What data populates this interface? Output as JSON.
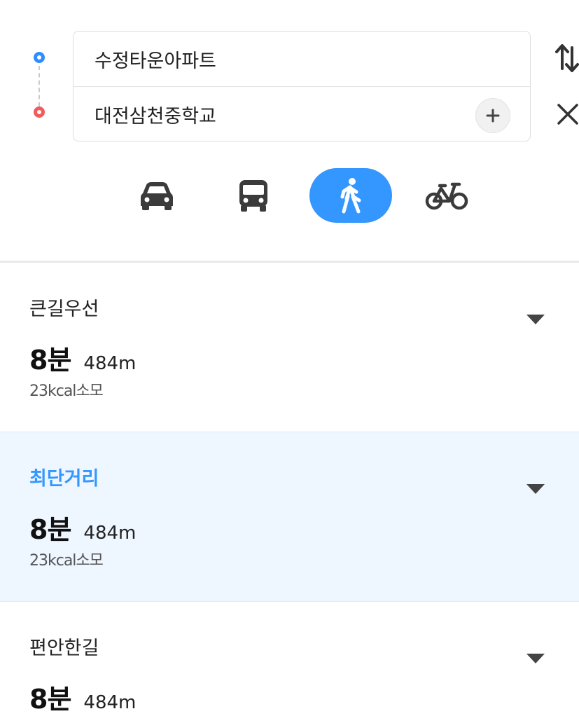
{
  "search": {
    "origin": "수정타운아파트",
    "destination": "대전삼천중학교"
  },
  "icons": {
    "origin_marker": "origin-marker-icon",
    "destination_marker": "destination-marker-icon",
    "add": "plus-icon",
    "swap": "swap-icon",
    "close": "close-icon",
    "car": "car-icon",
    "bus": "bus-icon",
    "walk": "walk-icon",
    "bike": "bicycle-icon",
    "expand": "chevron-down-icon"
  },
  "modes": {
    "selected": "walk"
  },
  "colors": {
    "accent": "#3397ff",
    "origin": "#2e8dff",
    "destination": "#f25b5b",
    "selected_row_bg": "#eef6ff"
  },
  "routes": [
    {
      "name": "큰길우선",
      "time": "8분",
      "distance": "484m",
      "kcal": "23kcal소모"
    },
    {
      "name": "최단거리",
      "time": "8분",
      "distance": "484m",
      "kcal": "23kcal소모"
    },
    {
      "name": "편안한길",
      "time": "8분",
      "distance": "484m"
    }
  ]
}
